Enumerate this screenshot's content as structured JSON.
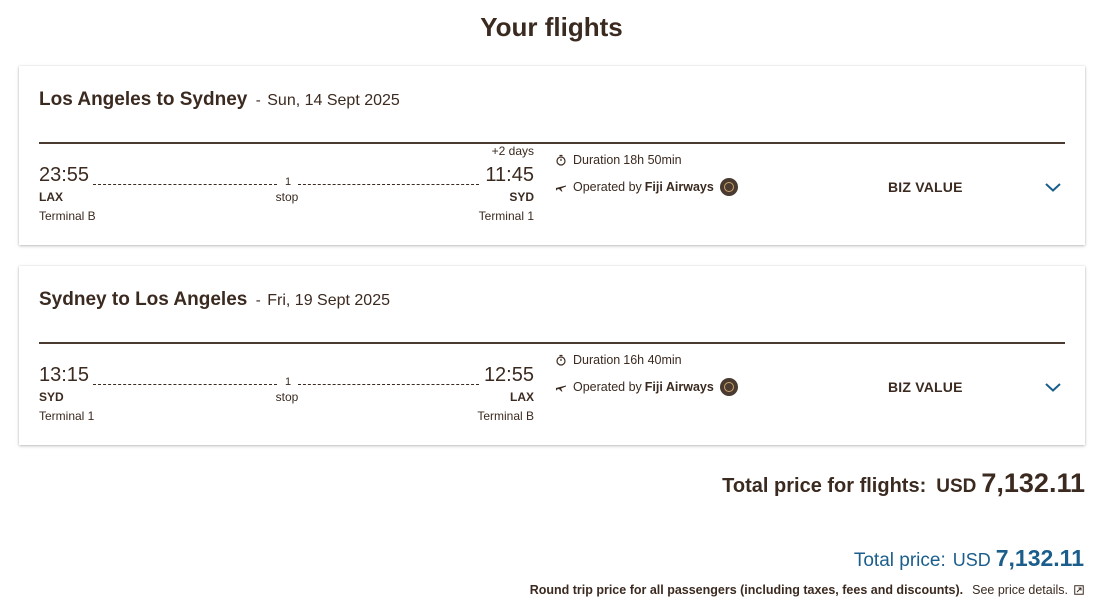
{
  "page": {
    "title": "Your flights"
  },
  "flights": [
    {
      "route": "Los Angeles to Sydney",
      "separator": "-",
      "date": "Sun, 14 Sept 2025",
      "plus_days": "+2 days",
      "departure": {
        "time": "23:55",
        "code": "LAX",
        "terminal": "Terminal B"
      },
      "arrival": {
        "time": "11:45",
        "code": "SYD",
        "terminal": "Terminal 1"
      },
      "stops": {
        "count": "1",
        "label": "stop"
      },
      "duration_label": "Duration",
      "duration": "18h 50min",
      "operated_label": "Operated by",
      "airline": "Fiji Airways",
      "fare": "BIZ VALUE"
    },
    {
      "route": "Sydney to Los Angeles",
      "separator": "-",
      "date": "Fri, 19 Sept 2025",
      "plus_days": "",
      "departure": {
        "time": "13:15",
        "code": "SYD",
        "terminal": "Terminal 1"
      },
      "arrival": {
        "time": "12:55",
        "code": "LAX",
        "terminal": "Terminal B"
      },
      "stops": {
        "count": "1",
        "label": "stop"
      },
      "duration_label": "Duration",
      "duration": "16h 40min",
      "operated_label": "Operated by",
      "airline": "Fiji Airways",
      "fare": "BIZ VALUE"
    }
  ],
  "summary": {
    "flights_total_label": "Total price for flights:",
    "flights_total_currency": "USD",
    "flights_total_amount": "7,132.11",
    "total_label": "Total price:",
    "total_currency": "USD",
    "total_amount": "7,132.11",
    "footnote": "Round trip price for all passengers (including taxes, fees and discounts).",
    "details_link": "See price details."
  },
  "icons": {
    "duration": "stopwatch-icon",
    "operated": "plane-icon",
    "airline_logo": "fiji-airways-logo",
    "expand": "chevron-down-icon",
    "external": "external-link-icon"
  },
  "colors": {
    "text": "#3b2a20",
    "accent": "#1b5e8c",
    "chevron": "#1b5e8c"
  }
}
